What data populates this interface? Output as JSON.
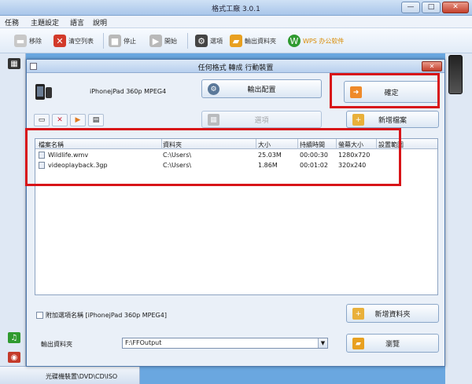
{
  "app": {
    "title": "格式工廠 3.0.1"
  },
  "window_controls": {
    "minimize": "—",
    "maximize": "□",
    "close": "✕"
  },
  "menu": [
    "任務",
    "主題設定",
    "語言",
    "說明"
  ],
  "toolbar": [
    {
      "label": "移除",
      "icon": "remove-icon",
      "color": "#c8c8c8"
    },
    {
      "label": "清空列表",
      "icon": "clear-list-icon",
      "color": "#d23a2a"
    },
    {
      "label": "停止",
      "icon": "stop-icon",
      "color": "#b9b9b9"
    },
    {
      "label": "開始",
      "icon": "start-icon",
      "color": "#b9b9b9"
    },
    {
      "label": "選項",
      "icon": "options-icon",
      "color": "#444444"
    },
    {
      "label": "輸出資料夾",
      "icon": "output-folder-icon",
      "color": "#e8a020"
    },
    {
      "label": "WPS 办公软件",
      "icon": "wps-icon",
      "color": "#2f9a2f"
    }
  ],
  "dialog": {
    "title": "任何格式 轉成 行動裝置",
    "profile": "iPhonejPad 360p MPEG4",
    "buttons": {
      "output_settings": "輸出配置",
      "ok": "確定",
      "options": "選項",
      "add_file": "新增檔案",
      "add_folder": "新增資料夾",
      "browse": "瀏覽"
    },
    "columns": [
      "檔案名稱",
      "資料夾",
      "大小",
      "持續時間",
      "螢幕大小",
      "設置範圍"
    ],
    "files": [
      {
        "name": "Wildlife.wmv",
        "folder": "C:\\Users\\",
        "size": "25.03M",
        "duration": "00:00:30",
        "screen": "1280x720",
        "range": ""
      },
      {
        "name": "videoplayback.3gp",
        "folder": "C:\\Users\\",
        "size": "1.86M",
        "duration": "00:01:02",
        "screen": "320x240",
        "range": ""
      }
    ],
    "append_option": "附加選項名稱 [iPhonejPad 360p MPEG4]",
    "output_folder_label": "輸出資料夾",
    "output_folder_value": "F:\\FFOutput"
  },
  "bottom_tab": "光碟機裝置\\DVD\\CD\\ISO",
  "colors": {
    "accent": "#4e78ad",
    "annotation": "#d81418"
  }
}
